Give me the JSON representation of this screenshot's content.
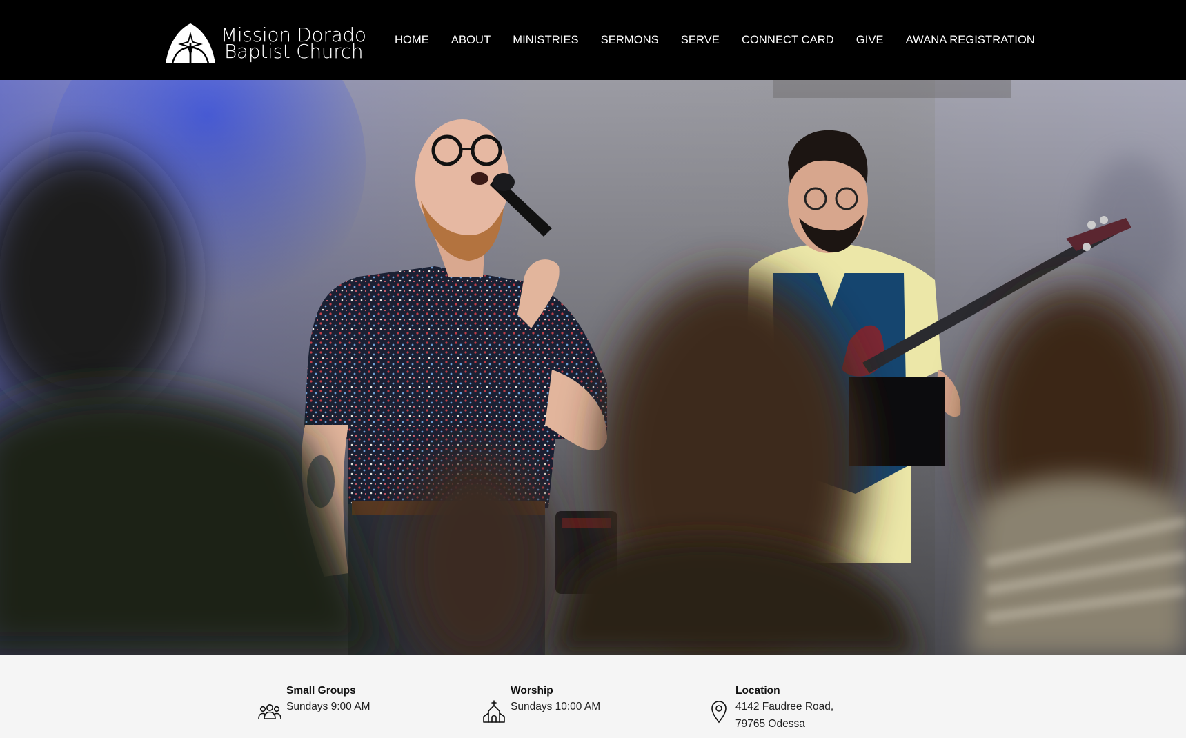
{
  "header": {
    "logo": {
      "line1": "Mission Dorado",
      "line2": "Baptist Church",
      "icon": "church-arch-star-logo-icon"
    },
    "nav": [
      {
        "label": "HOME"
      },
      {
        "label": "ABOUT"
      },
      {
        "label": "MINISTRIES"
      },
      {
        "label": "SERMONS"
      },
      {
        "label": "SERVE"
      },
      {
        "label": "CONNECT CARD"
      },
      {
        "label": "GIVE"
      },
      {
        "label": "AWANA REGISTRATION"
      }
    ]
  },
  "hero": {
    "image": "worship-leader-singing-with-bassist-photo"
  },
  "info": {
    "small_groups": {
      "title": "Small Groups",
      "line1": "Sundays 9:00 AM",
      "icon": "people-group-icon"
    },
    "worship": {
      "title": "Worship",
      "line1": "Sundays 10:00 AM",
      "icon": "church-icon"
    },
    "location": {
      "title": "Location",
      "line1": "4142 Faudree Road,",
      "line2": "79765 Odessa",
      "icon": "map-pin-icon"
    }
  },
  "colors": {
    "header_bg": "#000000",
    "nav_text": "#ffffff",
    "info_bg": "#f5f5f5"
  }
}
